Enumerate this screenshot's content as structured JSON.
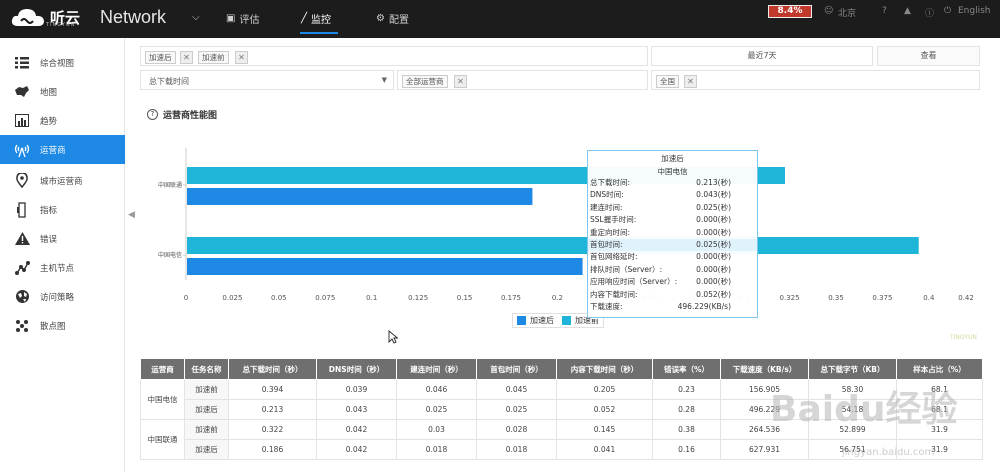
{
  "header": {
    "logo_text": "听云",
    "logo_sub": "TINGYUN",
    "product": "Network",
    "nav": [
      {
        "label": "评估",
        "icon": "thumbs-up-icon"
      },
      {
        "label": "监控",
        "icon": "line-chart-icon"
      },
      {
        "label": "配置",
        "icon": "gear-icon"
      }
    ],
    "cpu": "8.4%",
    "location": "北京",
    "language": "English"
  },
  "sidebar": {
    "items": [
      {
        "label": "综合视图",
        "icon": "list-icon"
      },
      {
        "label": "地图",
        "icon": "map-icon"
      },
      {
        "label": "趋势",
        "icon": "bar-chart-icon"
      },
      {
        "label": "运营商",
        "icon": "antenna-icon"
      },
      {
        "label": "城市运营商",
        "icon": "location-pin-icon"
      },
      {
        "label": "指标",
        "icon": "gauge-icon"
      },
      {
        "label": "错误",
        "icon": "warning-icon"
      },
      {
        "label": "主机节点",
        "icon": "nodes-icon"
      },
      {
        "label": "访问策略",
        "icon": "globe-icon"
      },
      {
        "label": "散点图",
        "icon": "scatter-icon"
      }
    ],
    "active_index": 3
  },
  "filters": {
    "tags": [
      "加速后",
      "加速前"
    ],
    "time_range": "最近7天",
    "query_button": "查看",
    "metric": "总下载时间",
    "carrier_tag": "全部运营商",
    "region_tag": "全国"
  },
  "chart": {
    "title": "运营商性能图",
    "tooltip": {
      "series": "加速后",
      "carrier": "中国电信",
      "rows": [
        {
          "label": "总下载时间:",
          "value": "0.213(秒)"
        },
        {
          "label": "DNS时间:",
          "value": "0.043(秒)"
        },
        {
          "label": "建连时间:",
          "value": "0.025(秒)"
        },
        {
          "label": "SSL握手时间:",
          "value": "0.000(秒)"
        },
        {
          "label": "重定向时间:",
          "value": "0.000(秒)"
        },
        {
          "label": "首包时间:",
          "value": "0.025(秒)"
        },
        {
          "label": "首包网络延时:",
          "value": "0.000(秒)"
        },
        {
          "label": "排队时间（Server）:",
          "value": "0.000(秒)"
        },
        {
          "label": "应用响应时间（Server）:",
          "value": "0.000(秒)"
        },
        {
          "label": "内容下载时间:",
          "value": "0.052(秒)"
        },
        {
          "label": "下载速度:",
          "value": "496.229(KB/s)"
        }
      ]
    },
    "watermark": "TINGYUN"
  },
  "chart_data": {
    "type": "bar",
    "orientation": "horizontal",
    "categories": [
      "中国联通",
      "中国电信"
    ],
    "series": [
      {
        "name": "加速前",
        "values": [
          0.322,
          0.394
        ],
        "color": "#1fb5d9"
      },
      {
        "name": "加速后",
        "values": [
          0.186,
          0.213
        ],
        "color": "#1e88e5"
      }
    ],
    "xlim": [
      0,
      0.42
    ],
    "xticks": [
      "0",
      "0.025",
      "0.05",
      "0.075",
      "0.1",
      "0.125",
      "0.15",
      "0.175",
      "0.2",
      "0.225",
      "0.25",
      "0.275",
      "0.3",
      "0.325",
      "0.35",
      "0.375",
      "0.4",
      "0.42"
    ],
    "legend": [
      "加速后",
      "加速前"
    ],
    "legend_position": "bottom-center"
  },
  "table": {
    "headers": [
      "运营商",
      "任务名称",
      "总下载时间（秒）",
      "DNS时间（秒）",
      "建连时间（秒）",
      "首包时间（秒）",
      "内容下载时间（秒）",
      "错误率（%）",
      "下载速度（KB/s）",
      "总下载字节（KB）",
      "样本占比（%）"
    ],
    "groups": [
      {
        "carrier": "中国电信",
        "rows": [
          [
            "加速前",
            "0.394",
            "0.039",
            "0.046",
            "0.045",
            "0.205",
            "0.23",
            "156.905",
            "58.30",
            "68.1"
          ],
          [
            "加速后",
            "0.213",
            "0.043",
            "0.025",
            "0.025",
            "0.052",
            "0.28",
            "496.229",
            "54.18",
            "68.1"
          ]
        ]
      },
      {
        "carrier": "中国联通",
        "rows": [
          [
            "加速前",
            "0.322",
            "0.042",
            "0.03",
            "0.028",
            "0.145",
            "0.38",
            "264.536",
            "52.899",
            "31.9"
          ],
          [
            "加速后",
            "0.186",
            "0.042",
            "0.018",
            "0.018",
            "0.041",
            "0.16",
            "627.931",
            "56.751",
            "31.9"
          ]
        ]
      }
    ]
  },
  "overlay": {
    "watermark": "Baidu经验",
    "watermark_url": "jingyan.baidu.com"
  }
}
